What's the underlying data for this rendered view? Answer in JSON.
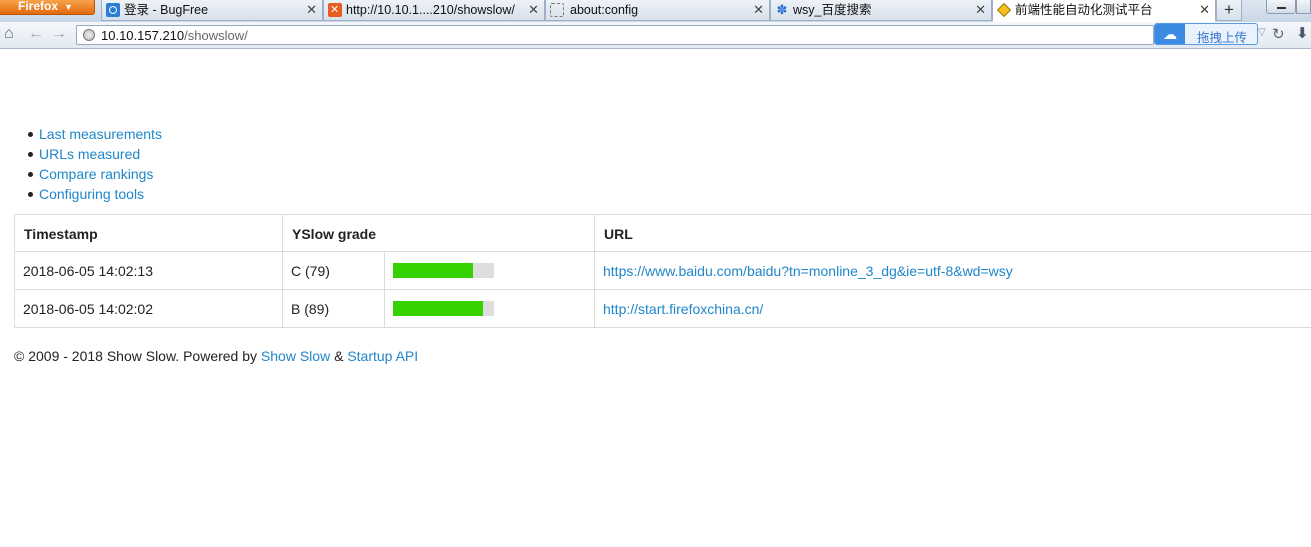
{
  "browser": {
    "menu_button": "Firefox",
    "tabs": [
      {
        "label": "登录 - BugFree",
        "icon": "bugfree-icon",
        "active": false
      },
      {
        "label": "http://10.10.1....210/showslow/",
        "icon": "xampp-icon",
        "active": false
      },
      {
        "label": "about:config",
        "icon": "blank-page-icon",
        "active": false
      },
      {
        "label": "wsy_百度搜索",
        "icon": "baidu-paw-icon",
        "active": false
      },
      {
        "label": "前端性能自动化测试平台",
        "icon": "showslow-diamond-icon",
        "active": true
      }
    ],
    "address": {
      "host": "10.10.157.210",
      "path": "/showslow/"
    },
    "extension_label": "拖拽上传"
  },
  "nav_menu": [
    "Last measurements",
    "URLs measured",
    "Compare rankings",
    "Configuring tools"
  ],
  "table": {
    "headers": {
      "timestamp": "Timestamp",
      "grade": "YSlow grade",
      "url": "URL"
    },
    "rows": [
      {
        "timestamp": "2018-06-05 14:02:13",
        "grade": "C (79)",
        "score": 79,
        "url": "https://www.baidu.com/baidu?tn=monline_3_dg&ie=utf-8&wd=wsy"
      },
      {
        "timestamp": "2018-06-05 14:02:02",
        "grade": "B (89)",
        "score": 89,
        "url": "http://start.firefoxchina.cn/"
      }
    ]
  },
  "footer": {
    "copyright": "© 2009 - 2018 Show Slow. Powered by ",
    "link1": "Show Slow",
    "separator": " & ",
    "link2": "Startup API"
  },
  "colors": {
    "link": "#1f86c9",
    "bar_fill": "#36d100",
    "bar_track": "#dedede"
  }
}
